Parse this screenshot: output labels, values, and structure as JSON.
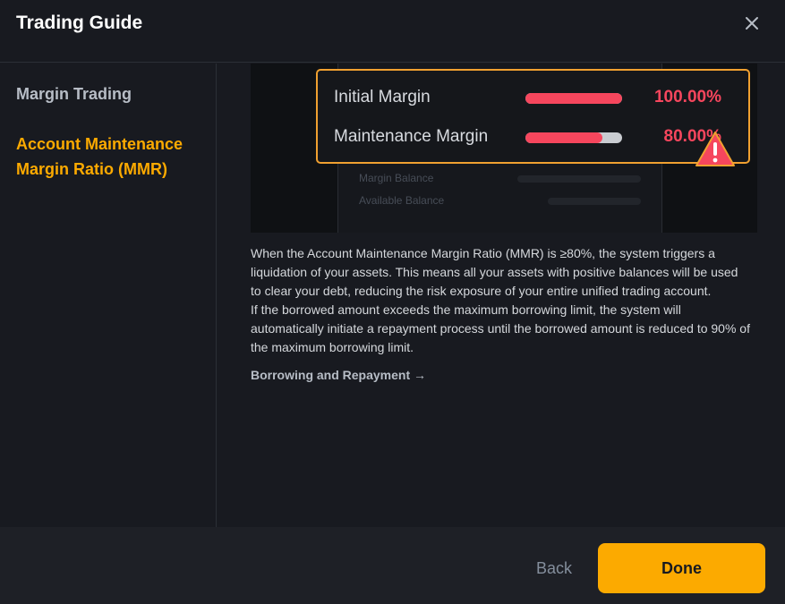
{
  "header": {
    "title": "Trading Guide",
    "close_icon": "close-icon"
  },
  "sidebar": {
    "items": [
      {
        "label": "Margin Trading",
        "active": false
      },
      {
        "label": "Account Maintenance Margin Ratio (MMR)",
        "active": true
      }
    ]
  },
  "illustration": {
    "rows": [
      {
        "label": "Initial Margin",
        "value": "100.00%",
        "fill_percent": 100
      },
      {
        "label": "Maintenance Margin",
        "value": "80.00%",
        "fill_percent": 80
      }
    ],
    "background_labels": [
      "Margin Balance",
      "Available Balance"
    ],
    "warning_icon": "warning-triangle-icon",
    "colors": {
      "accent": "#f6465d",
      "border": "#f0a030"
    }
  },
  "description": {
    "paragraph1": "When the Account Maintenance Margin Ratio (MMR) is ≥80%, the system triggers a liquidation of your assets. This means all your assets with positive balances will be used to clear your debt, reducing the risk exposure of your entire unified trading account.",
    "paragraph2": "If the borrowed amount exceeds the maximum borrowing limit, the system will automatically initiate a repayment process until the borrowed amount is reduced to 90% of the maximum borrowing limit."
  },
  "link": {
    "label": "Borrowing and Repayment →"
  },
  "footer": {
    "back_label": "Back",
    "done_label": "Done"
  },
  "colors": {
    "brand": "#fcaa00",
    "background": "#181a20",
    "footer": "#1e2026"
  }
}
